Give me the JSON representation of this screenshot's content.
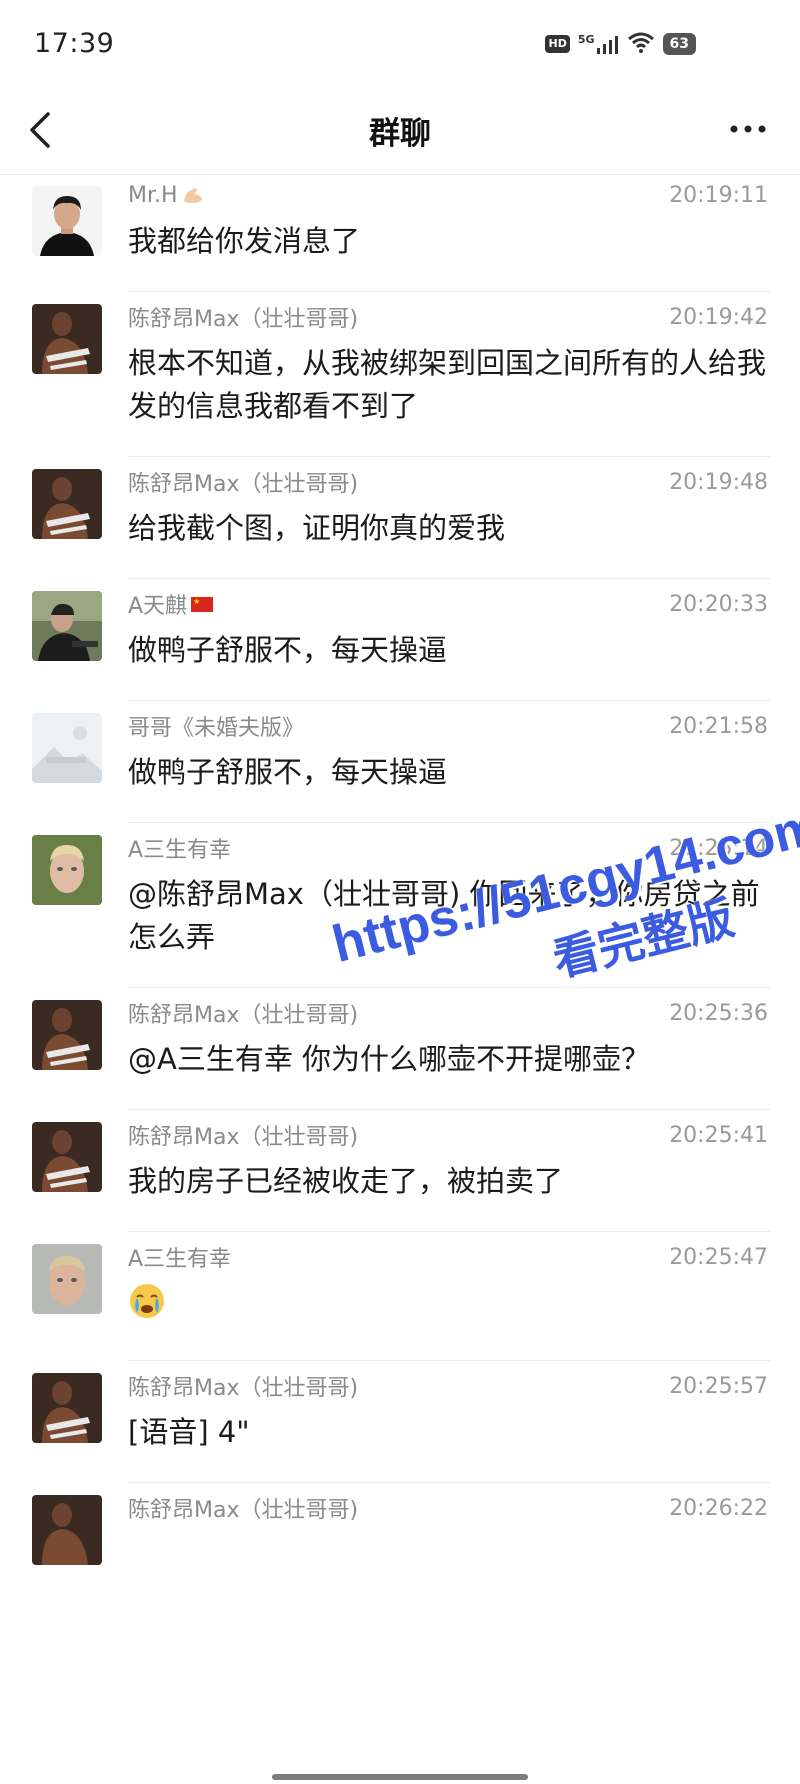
{
  "status_bar": {
    "time": "17:39",
    "hd": "HD",
    "network": "5G",
    "battery": "63"
  },
  "nav": {
    "title": "群聊"
  },
  "messages": [
    {
      "sender": "Mr.H",
      "badge": "flex-emoji",
      "time": "20:19:11",
      "text": "我都给你发消息了",
      "avatar": "man-black-shirt"
    },
    {
      "sender": "陈舒昂Max（壮壮哥哥)",
      "time": "20:19:42",
      "text": "根本不知道，从我被绑架到回国之间所有的人给我发的信息我都看不到了",
      "avatar": "tanned-man"
    },
    {
      "sender": "陈舒昂Max（壮壮哥哥)",
      "time": "20:19:48",
      "text": "给我截个图，证明你真的爱我",
      "avatar": "tanned-man"
    },
    {
      "sender": "A天麒",
      "badge": "china-flag",
      "time": "20:20:33",
      "text": "做鸭子舒服不，每天操逼",
      "avatar": "man-in-car"
    },
    {
      "sender": "哥哥《未婚夫版》",
      "time": "20:21:58",
      "text": "做鸭子舒服不，每天操逼",
      "avatar": "placeholder-image"
    },
    {
      "sender": "A三生有幸",
      "time": "20:25:14",
      "text": "@陈舒昂Max（壮壮哥哥) 你回来了，你房贷之前怎么弄",
      "avatar": "blond-man"
    },
    {
      "sender": "陈舒昂Max（壮壮哥哥)",
      "time": "20:25:36",
      "text": "@A三生有幸 你为什么哪壶不开提哪壶？",
      "avatar": "tanned-man"
    },
    {
      "sender": "陈舒昂Max（壮壮哥哥)",
      "time": "20:25:41",
      "text": "我的房子已经被收走了，被拍卖了",
      "avatar": "tanned-man"
    },
    {
      "sender": "A三生有幸",
      "time": "20:25:47",
      "text": "",
      "emoji": "crying-face",
      "avatar": "blond-man"
    },
    {
      "sender": "陈舒昂Max（壮壮哥哥)",
      "time": "20:25:57",
      "text": "[语音] 4\"",
      "avatar": "tanned-man"
    },
    {
      "sender": "陈舒昂Max（壮壮哥哥)",
      "time": "20:26:22",
      "text": "",
      "avatar": "tanned-man"
    }
  ],
  "watermark": {
    "url": "https://51cgy14.com",
    "label": "看完整版"
  },
  "colors": {
    "accent_watermark": "#3b5ce0",
    "divider": "#ebebeb",
    "meta_text": "#8a8a8a"
  }
}
